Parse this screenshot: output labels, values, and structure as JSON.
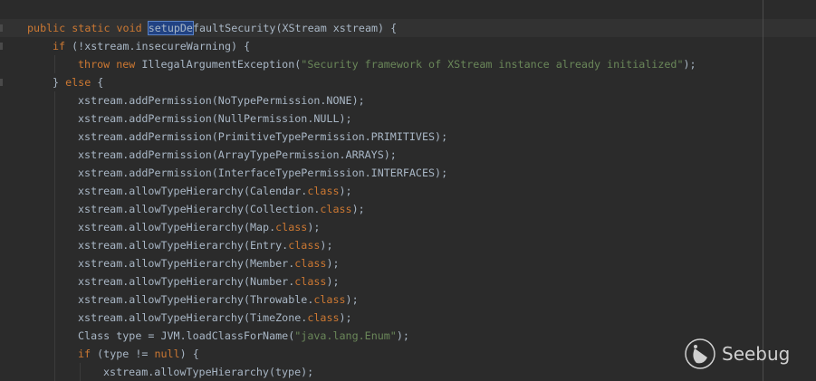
{
  "editor": {
    "current_line": 0,
    "lines": [
      {
        "indent": 0,
        "tokens": [
          [
            "public static void ",
            "kw"
          ],
          [
            "setupDe",
            "sel"
          ],
          [
            "faultSecurity(XStream xstream) {",
            "plain"
          ]
        ]
      },
      {
        "indent": 1,
        "tokens": [
          [
            "if ",
            "kw"
          ],
          [
            "(!xstream.insecureWarning) {",
            "plain"
          ]
        ]
      },
      {
        "indent": 2,
        "tokens": [
          [
            "throw new ",
            "kw"
          ],
          [
            "IllegalArgumentException(",
            "plain"
          ],
          [
            "\"Security framework of XStream instance already initialized\"",
            "str"
          ],
          [
            ");",
            "plain"
          ]
        ]
      },
      {
        "indent": 1,
        "tokens": [
          [
            "} ",
            "plain"
          ],
          [
            "else ",
            "kw"
          ],
          [
            "{",
            "plain"
          ]
        ]
      },
      {
        "indent": 2,
        "tokens": [
          [
            "xstream.addPermission(NoTypePermission.NONE);",
            "plain"
          ]
        ]
      },
      {
        "indent": 2,
        "tokens": [
          [
            "xstream.addPermission(NullPermission.NULL);",
            "plain"
          ]
        ]
      },
      {
        "indent": 2,
        "tokens": [
          [
            "xstream.addPermission(PrimitiveTypePermission.PRIMITIVES);",
            "plain"
          ]
        ]
      },
      {
        "indent": 2,
        "tokens": [
          [
            "xstream.addPermission(ArrayTypePermission.ARRAYS);",
            "plain"
          ]
        ]
      },
      {
        "indent": 2,
        "tokens": [
          [
            "xstream.addPermission(InterfaceTypePermission.INTERFACES);",
            "plain"
          ]
        ]
      },
      {
        "indent": 2,
        "tokens": [
          [
            "xstream.allowTypeHierarchy(Calendar.",
            "plain"
          ],
          [
            "class",
            "kw"
          ],
          [
            ");",
            "plain"
          ]
        ]
      },
      {
        "indent": 2,
        "tokens": [
          [
            "xstream.allowTypeHierarchy(Collection.",
            "plain"
          ],
          [
            "class",
            "kw"
          ],
          [
            ");",
            "plain"
          ]
        ]
      },
      {
        "indent": 2,
        "tokens": [
          [
            "xstream.allowTypeHierarchy(Map.",
            "plain"
          ],
          [
            "class",
            "kw"
          ],
          [
            ");",
            "plain"
          ]
        ]
      },
      {
        "indent": 2,
        "tokens": [
          [
            "xstream.allowTypeHierarchy(Entry.",
            "plain"
          ],
          [
            "class",
            "kw"
          ],
          [
            ");",
            "plain"
          ]
        ]
      },
      {
        "indent": 2,
        "tokens": [
          [
            "xstream.allowTypeHierarchy(Member.",
            "plain"
          ],
          [
            "class",
            "kw"
          ],
          [
            ");",
            "plain"
          ]
        ]
      },
      {
        "indent": 2,
        "tokens": [
          [
            "xstream.allowTypeHierarchy(Number.",
            "plain"
          ],
          [
            "class",
            "kw"
          ],
          [
            ");",
            "plain"
          ]
        ]
      },
      {
        "indent": 2,
        "tokens": [
          [
            "xstream.allowTypeHierarchy(Throwable.",
            "plain"
          ],
          [
            "class",
            "kw"
          ],
          [
            ");",
            "plain"
          ]
        ]
      },
      {
        "indent": 2,
        "tokens": [
          [
            "xstream.allowTypeHierarchy(TimeZone.",
            "plain"
          ],
          [
            "class",
            "kw"
          ],
          [
            ");",
            "plain"
          ]
        ]
      },
      {
        "indent": 2,
        "tokens": [
          [
            "Class type = JVM.loadClassForName(",
            "plain"
          ],
          [
            "\"java.lang.Enum\"",
            "str"
          ],
          [
            ");",
            "plain"
          ]
        ]
      },
      {
        "indent": 2,
        "tokens": [
          [
            "if ",
            "kw"
          ],
          [
            "(type != ",
            "plain"
          ],
          [
            "null",
            "kw"
          ],
          [
            ") {",
            "plain"
          ]
        ]
      },
      {
        "indent": 3,
        "tokens": [
          [
            "xstream.allowTypeHierarchy(type);",
            "plain"
          ]
        ]
      }
    ]
  },
  "watermark": {
    "text": "Seebug"
  },
  "colors": {
    "background": "#2b2b2b",
    "keyword": "#cc7832",
    "string": "#6a8759",
    "text": "#a9b7c6",
    "selection": "#214283"
  }
}
